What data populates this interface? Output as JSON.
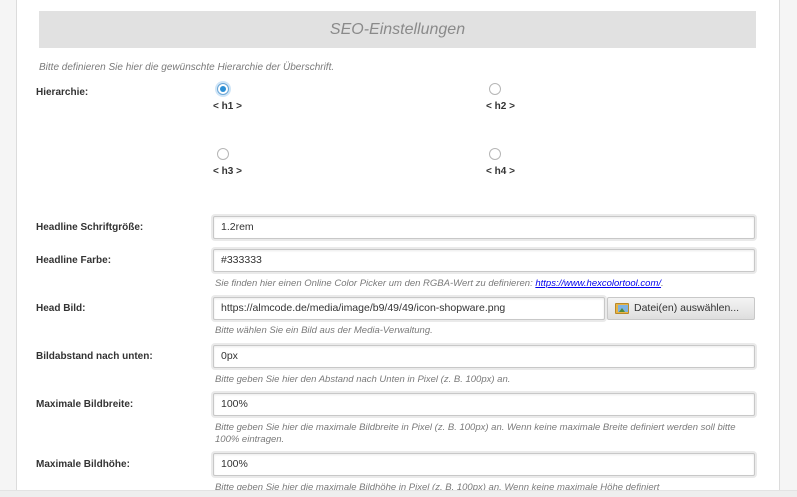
{
  "section": {
    "title": "SEO-Einstellungen",
    "intro": "Bitte definieren Sie hier die gewünschte Hierarchie der Überschrift."
  },
  "hierarchy": {
    "label": "Hierarchie:",
    "options": [
      {
        "label": "< h1 >",
        "checked": true
      },
      {
        "label": "< h2 >",
        "checked": false
      },
      {
        "label": "< h3 >",
        "checked": false
      },
      {
        "label": "< h4 >",
        "checked": false
      }
    ]
  },
  "fields": {
    "headline_size": {
      "label": "Headline Schriftgröße:",
      "value": "1.2rem"
    },
    "headline_color": {
      "label": "Headline Farbe:",
      "value": "#333333",
      "help_text": "Sie finden hier einen Online Color Picker um den RGBA-Wert zu definieren: ",
      "help_link": "https://www.hexcolortool.com/",
      "help_suffix": "."
    },
    "head_image": {
      "label": "Head Bild:",
      "value": "https://almcode.de/media/image/b9/49/49/icon-shopware.png",
      "button_label": "Datei(en) auswählen...",
      "help": "Bitte wählen Sie ein Bild aus der Media-Verwaltung."
    },
    "image_spacing": {
      "label": "Bildabstand nach unten:",
      "value": "0px",
      "help": "Bitte geben Sie hier den Abstand nach Unten in Pixel (z. B. 100px) an."
    },
    "max_width": {
      "label": "Maximale Bildbreite:",
      "value": "100%",
      "help": "Bitte geben Sie hier die maximale Bildbreite in Pixel (z. B. 100px) an. Wenn keine maximale Breite definiert werden soll bitte 100% eintragen."
    },
    "max_height": {
      "label": "Maximale Bildhöhe:",
      "value": "100%",
      "help": "Bitte geben Sie hier die maximale Bildhöhe in Pixel (z. B. 100px) an. Wenn keine maximale Höhe definiert"
    }
  },
  "colors": {
    "radio_accent": "#2d8fd5",
    "header_bg": "#e1e1e1",
    "link": "#0000ee"
  }
}
